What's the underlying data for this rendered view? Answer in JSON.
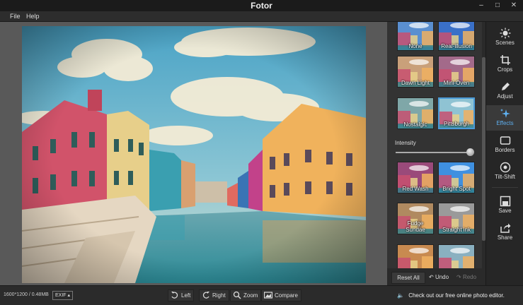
{
  "window": {
    "title": "Fotor",
    "minimize": "–",
    "maximize": "□",
    "close": "✕"
  },
  "menu": [
    {
      "label": "File"
    },
    {
      "label": "Help"
    }
  ],
  "effects_panel": {
    "thumbnails": [
      {
        "label": "None",
        "tint": "#5a8fd0",
        "selected": false
      },
      {
        "label": "Real-illusion",
        "tint": "#3a70c8",
        "selected": false
      },
      {
        "label": "Dawn Light",
        "tint": "#c9a07a",
        "selected": false
      },
      {
        "label": "Mini-Oven",
        "tint": "#a36a8a",
        "selected": false
      },
      {
        "label": "Nostalgic",
        "tint": "#7fa7a8",
        "selected": false
      },
      {
        "label": "Pittsburgh",
        "tint": "#8fc3d3",
        "selected": true
      },
      {
        "label": "Red Wash",
        "tint": "#9a4a7a",
        "selected": false
      },
      {
        "label": "Bright Spot",
        "tint": "#3f90e0",
        "selected": false
      },
      {
        "label": "Fudge Sundae",
        "tint": "#b08a60",
        "selected": false
      },
      {
        "label": "Straight ink",
        "tint": "#9a9a9a",
        "selected": false
      },
      {
        "label": "",
        "tint": "#c88a50",
        "selected": false
      },
      {
        "label": "",
        "tint": "#8ab0c0",
        "selected": false
      }
    ],
    "intensity": {
      "label": "Intensity",
      "value": 0.95
    },
    "reset_label": "Reset All",
    "undo_label": "Undo",
    "redo_label": "Redo"
  },
  "tools": [
    {
      "label": "Scenes",
      "icon": "sun-icon",
      "active": false
    },
    {
      "label": "Crops",
      "icon": "crop-icon",
      "active": false
    },
    {
      "label": "Adjust",
      "icon": "pencil-icon",
      "active": false
    },
    {
      "label": "Effects",
      "icon": "sparkle-icon",
      "active": true
    },
    {
      "label": "Borders",
      "icon": "border-icon",
      "active": false
    },
    {
      "label": "Tilt-Shift",
      "icon": "target-icon",
      "active": false
    },
    {
      "label": "Save",
      "icon": "save-icon",
      "active": false
    },
    {
      "label": "Share",
      "icon": "share-icon",
      "active": false
    }
  ],
  "status": {
    "dimensions": "1600*1200 / 0.48MB",
    "exif_label": "EXIF",
    "rotate_left": "Left",
    "rotate_right": "Right",
    "zoom": "Zoom",
    "compare": "Compare",
    "promo": "Check out our free online photo editor."
  },
  "colors": {
    "accent": "#4a9ad8",
    "active_label": "#5fb0f0"
  }
}
